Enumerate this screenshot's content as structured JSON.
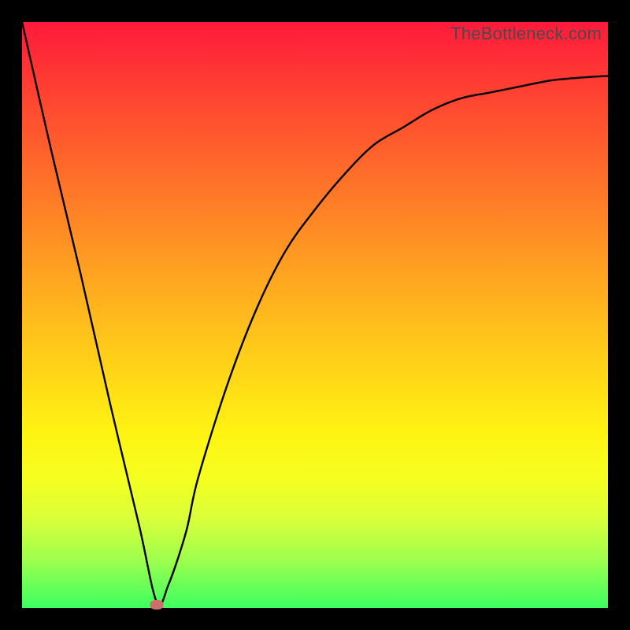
{
  "watermark": "TheBottleneck.com",
  "chart_data": {
    "type": "line",
    "title": "",
    "xlabel": "",
    "ylabel": "",
    "xlim": [
      0,
      100
    ],
    "ylim": [
      0,
      100
    ],
    "grid": false,
    "legend": false,
    "series": [
      {
        "name": "bottleneck-curve",
        "x": [
          0,
          5,
          10,
          15,
          20,
          23,
          25,
          28,
          30,
          35,
          40,
          45,
          50,
          55,
          60,
          65,
          70,
          75,
          80,
          85,
          90,
          95,
          100
        ],
        "y": [
          100,
          78,
          57,
          35,
          14,
          1,
          4,
          13,
          22,
          38,
          51,
          61,
          68,
          74,
          79,
          82,
          85,
          87,
          88,
          89,
          90,
          90.5,
          90.8
        ]
      }
    ],
    "annotations": [
      {
        "name": "optimal-point",
        "x": 23,
        "y": 0.5,
        "color": "#ce6e6e"
      }
    ],
    "gradient_stops": [
      {
        "pos": 0,
        "color": "#ff1a3c"
      },
      {
        "pos": 10,
        "color": "#ff3b33"
      },
      {
        "pos": 25,
        "color": "#ff6a2a"
      },
      {
        "pos": 40,
        "color": "#ff9a22"
      },
      {
        "pos": 55,
        "color": "#ffc81a"
      },
      {
        "pos": 70,
        "color": "#fff312"
      },
      {
        "pos": 78,
        "color": "#f5ff20"
      },
      {
        "pos": 85,
        "color": "#d8ff3a"
      },
      {
        "pos": 92,
        "color": "#9cff4e"
      },
      {
        "pos": 100,
        "color": "#3cff60"
      }
    ]
  }
}
